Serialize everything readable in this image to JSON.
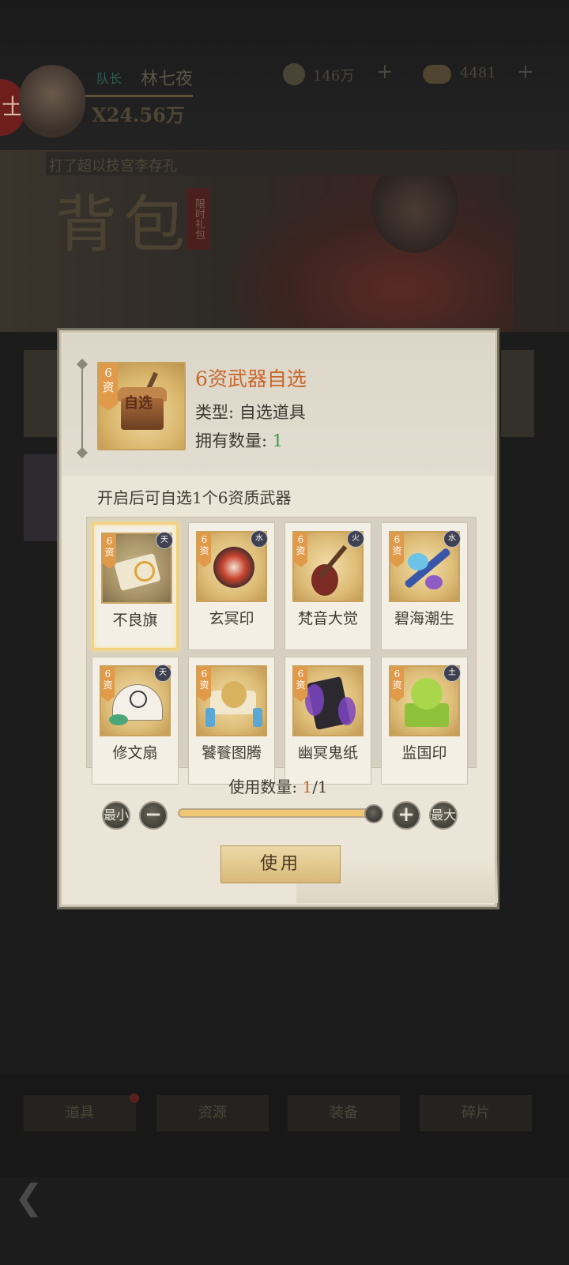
{
  "background": {
    "player_rank": "队长",
    "player_name": "林七夜",
    "power": "X24.56万",
    "coins": "146万",
    "ingots": "4481",
    "banner_title": "打了超以技宫李存孔",
    "page_title": "背包",
    "seal_char": "士",
    "side_tag": "限时礼包",
    "tabs": [
      "道具",
      "资源",
      "装备",
      "碎片"
    ]
  },
  "modal": {
    "item": {
      "name": "6资武器自选",
      "type_label": "类型:",
      "type_value": "自选道具",
      "own_label": "拥有数量:",
      "own_value": "1",
      "grade": "6资",
      "icon_text": "自选"
    },
    "description": "开启后可自选1个6资质武器",
    "options": [
      {
        "name": "不良旗",
        "grade": "6资",
        "element": "天",
        "selected": true
      },
      {
        "name": "玄冥印",
        "grade": "6资",
        "element": "水",
        "selected": false
      },
      {
        "name": "梵音大觉",
        "grade": "6资",
        "element": "火",
        "selected": false
      },
      {
        "name": "碧海潮生",
        "grade": "6资",
        "element": "水",
        "selected": false
      },
      {
        "name": "修文扇",
        "grade": "6资",
        "element": "天",
        "selected": false
      },
      {
        "name": "饕餮图腾",
        "grade": "6资",
        "element": "",
        "selected": false
      },
      {
        "name": "幽冥鬼纸",
        "grade": "6资",
        "element": "",
        "selected": false
      },
      {
        "name": "监国印",
        "grade": "6资",
        "element": "土",
        "selected": false
      }
    ],
    "use_count": {
      "label": "使用数量:",
      "current": "1",
      "max": "/1"
    },
    "min_label": "最小",
    "max_label": "最大",
    "minus": "−",
    "plus": "+",
    "slider_fraction": 1.0,
    "use_button": "使用"
  }
}
